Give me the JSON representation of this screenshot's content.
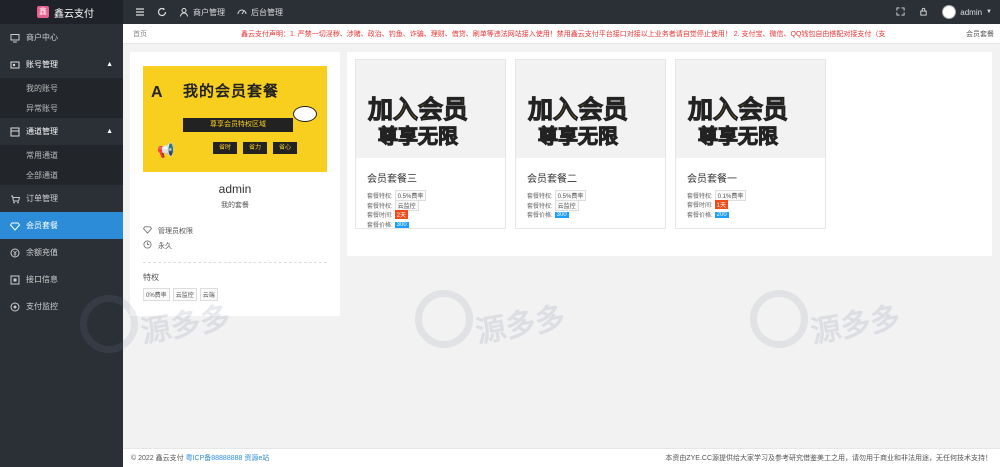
{
  "app": {
    "title": "鑫云支付",
    "logo_glyph": "鑫"
  },
  "sidebar": {
    "items": [
      {
        "label": "商户中心"
      },
      {
        "label": "账号管理",
        "children": [
          "我的账号",
          "异常账号"
        ]
      },
      {
        "label": "通道管理",
        "children": [
          "常用通道",
          "全部通道"
        ]
      },
      {
        "label": "订单管理"
      },
      {
        "label": "会员套餐",
        "active": true
      },
      {
        "label": "余额充值"
      },
      {
        "label": "接口信息"
      },
      {
        "label": "支付监控"
      }
    ]
  },
  "topbar": {
    "merchant": "商户管理",
    "backend": "后台管理",
    "user": "admin"
  },
  "breadcrumb": {
    "home": "首页",
    "notice": "鑫云支付声明：1. 严禁一切淫秽、涉赌、政治、钓鱼、诈骗、理财、借贷、刷单等违法网站接入使用！禁用鑫云支付平台接口对接以上业务者请自觉停止使用！ 2. 支付宝、微信、QQ钱包自由搭配对接支付（支",
    "current": "会员套餐"
  },
  "profile": {
    "banner_title": "我的会员套餐",
    "banner_subtitle": "尊享会员特权区域",
    "banner_badges": [
      "省时",
      "省力",
      "省心"
    ],
    "name": "admin",
    "subtitle": "我的套餐",
    "permission": "管理员权限",
    "duration": "永久",
    "privilege_title": "特权",
    "tags": [
      "0%费率",
      "云监控",
      "云端"
    ]
  },
  "packages": [
    {
      "banner1": "加入会员",
      "banner2": "尊享无限",
      "title": "会员套餐三",
      "rate_label": "套餐特权:",
      "rate": "0.5%费率",
      "feature_label": "套餐特权:",
      "feature": "云监控",
      "time_label": "套餐时间:",
      "time": "2天",
      "price_label": "套餐价格:",
      "price": "300"
    },
    {
      "banner1": "加入会员",
      "banner2": "尊享无限",
      "title": "会员套餐二",
      "rate_label": "套餐特权:",
      "rate": "0.5%费率",
      "feature_label": "套餐特权:",
      "feature": "云监控",
      "time_label": "",
      "time": "",
      "price_label": "套餐价格:",
      "price": "300"
    },
    {
      "banner1": "加入会员",
      "banner2": "尊享无限",
      "title": "会员套餐一",
      "rate_label": "套餐特权:",
      "rate": "0.1%费率",
      "feature_label": "",
      "feature": "",
      "time_label": "套餐时间:",
      "time": "1天",
      "price_label": "套餐价格:",
      "price": "200"
    }
  ],
  "footer": {
    "copyright": "© 2022 鑫云支付",
    "icp": "粤ICP备88888888",
    "site": "资源e站",
    "disclaimer": "本资由ZYE.CC源提供给大家学习及参考研究借鉴美工之用，请勿用于商业和非法用途，无任何技术支持！"
  },
  "watermark": {
    "text": "源多多"
  },
  "colors": {
    "sidebar": "#2b2f36",
    "active": "#2d8cd8",
    "notice": "#ee3333",
    "badge_red": "#f04a1a",
    "badge_blue": "#1e9fff",
    "banner_yellow": "#f8cf1f"
  }
}
